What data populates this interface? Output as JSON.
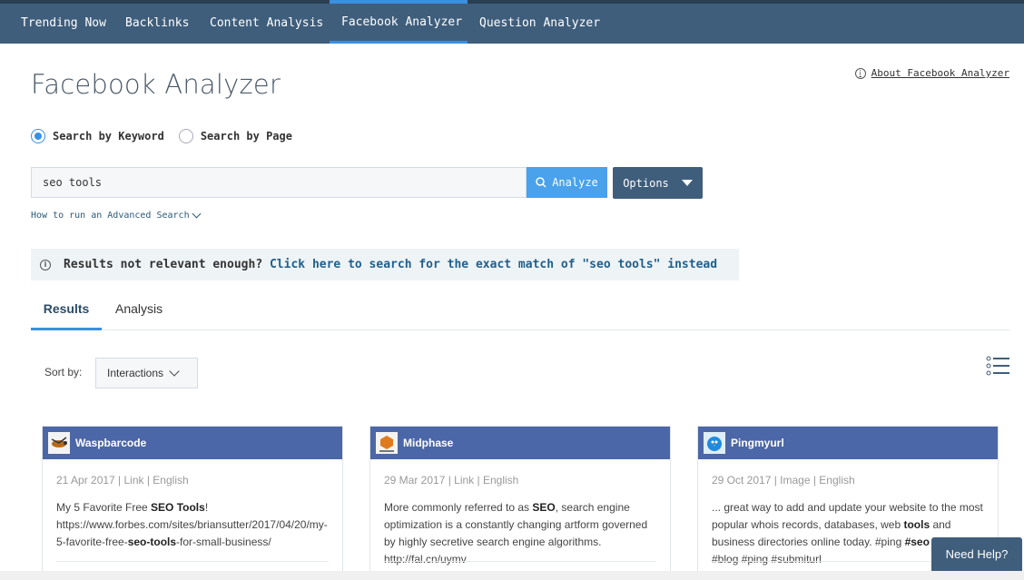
{
  "nav": {
    "tabs": [
      {
        "label": "Trending Now"
      },
      {
        "label": "Backlinks"
      },
      {
        "label": "Content Analysis"
      },
      {
        "label": "Facebook Analyzer"
      },
      {
        "label": "Question Analyzer"
      }
    ],
    "active_tab": "Facebook Analyzer"
  },
  "header": {
    "title": "Facebook Analyzer",
    "about_link": "About Facebook Analyzer"
  },
  "search": {
    "mode_keyword": "Search by Keyword",
    "mode_page": "Search by Page",
    "selected_mode": "keyword",
    "value": "seo tools",
    "analyze_label": "Analyze",
    "options_label": "Options",
    "advanced_link": "How to run an Advanced Search"
  },
  "notice": {
    "prefix": "Results not relevant enough?",
    "link": "Click here to search for the exact match of \"seo tools\" instead"
  },
  "results_tabs": [
    {
      "label": "Results"
    },
    {
      "label": "Analysis"
    }
  ],
  "sort": {
    "label": "Sort by:",
    "value": "Interactions"
  },
  "cards": [
    {
      "name": "Waspbarcode",
      "meta": "21 Apr 2017 | Link | English",
      "text_parts": [
        {
          "t": "My 5 Favorite Free ",
          "b": false
        },
        {
          "t": "SEO Tools",
          "b": true
        },
        {
          "t": "! https://www.forbes.com/sites/briansutter/2017/04/20/my-5-favorite-free-",
          "b": false
        },
        {
          "t": "seo-tools",
          "b": true
        },
        {
          "t": "-for-small-business/",
          "b": false
        }
      ]
    },
    {
      "name": "Midphase",
      "meta": "29 Mar 2017 | Link | English",
      "text_parts": [
        {
          "t": "More commonly referred to as ",
          "b": false
        },
        {
          "t": "SEO",
          "b": true
        },
        {
          "t": ", search engine optimization is a constantly changing artform governed by highly secretive search engine algorithms. http://fal.cn/uymv",
          "b": false
        }
      ]
    },
    {
      "name": "Pingmyurl",
      "meta": "29 Oct 2017 | Image | English",
      "text_parts": [
        {
          "t": "... great way to add and update your website to the most popular whois records, databases, web ",
          "b": false
        },
        {
          "t": "tools",
          "b": true
        },
        {
          "t": " and business directories online today. #ping ",
          "b": false
        },
        {
          "t": "#seo",
          "b": true
        },
        {
          "t": " #free #blog #ping #submiturl",
          "b": false
        }
      ]
    }
  ],
  "help": {
    "label": "Need Help?"
  },
  "colors": {
    "nav_bg": "#3f5e7c",
    "accent": "#3a8fe0",
    "card_header": "#4c67a7"
  }
}
